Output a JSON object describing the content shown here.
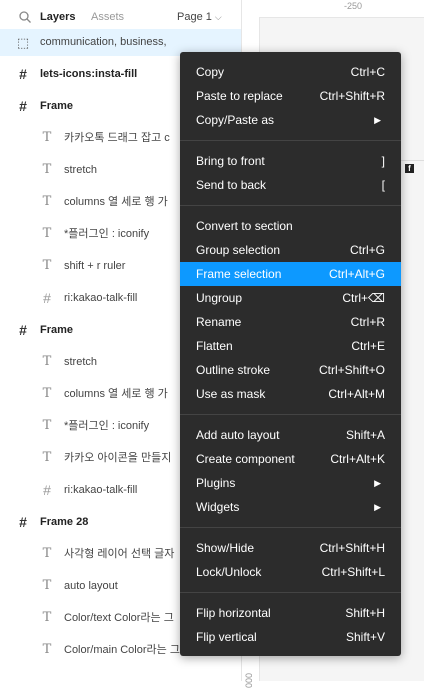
{
  "panel": {
    "tabs": {
      "layers": "Layers",
      "assets": "Assets"
    },
    "page_selector": "Page 1",
    "layers": [
      {
        "label": "communication, business, ",
        "icon": "dashed-frame",
        "indent": 0,
        "bold": false,
        "selected": true
      },
      {
        "label": "lets-icons:insta-fill",
        "icon": "frame",
        "indent": 0,
        "bold": true,
        "selected": false
      },
      {
        "label": "Frame",
        "icon": "frame",
        "indent": 0,
        "bold": true,
        "selected": false
      },
      {
        "label": "카카오톡 드래그 잡고 c",
        "icon": "text",
        "indent": 1,
        "bold": false,
        "selected": false
      },
      {
        "label": "stretch",
        "icon": "text",
        "indent": 1,
        "bold": false,
        "selected": false
      },
      {
        "label": "columns 열 세로 행 가",
        "icon": "text",
        "indent": 1,
        "bold": false,
        "selected": false
      },
      {
        "label": "*플러그인 : iconify",
        "icon": "text",
        "indent": 1,
        "bold": false,
        "selected": false
      },
      {
        "label": "shift + r ruler",
        "icon": "text",
        "indent": 1,
        "bold": false,
        "selected": false
      },
      {
        "label": "ri:kakao-talk-fill",
        "icon": "grid",
        "indent": 1,
        "bold": false,
        "selected": false
      },
      {
        "label": "Frame",
        "icon": "frame",
        "indent": 0,
        "bold": true,
        "selected": false
      },
      {
        "label": "stretch",
        "icon": "text",
        "indent": 1,
        "bold": false,
        "selected": false
      },
      {
        "label": "columns 열 세로 행 가",
        "icon": "text",
        "indent": 1,
        "bold": false,
        "selected": false
      },
      {
        "label": "*플러그인 : iconify",
        "icon": "text",
        "indent": 1,
        "bold": false,
        "selected": false
      },
      {
        "label": "카카오 아이콘을 만들지",
        "icon": "text",
        "indent": 1,
        "bold": false,
        "selected": false
      },
      {
        "label": "ri:kakao-talk-fill",
        "icon": "grid",
        "indent": 1,
        "bold": false,
        "selected": false
      },
      {
        "label": "Frame 28",
        "icon": "frame",
        "indent": 0,
        "bold": true,
        "selected": false
      },
      {
        "label": "사각형 레이어 선택 글자",
        "icon": "text",
        "indent": 1,
        "bold": false,
        "selected": false
      },
      {
        "label": "auto layout",
        "icon": "text",
        "indent": 1,
        "bold": false,
        "selected": false
      },
      {
        "label": "Color/text Color라는 그",
        "icon": "text",
        "indent": 1,
        "bold": false,
        "selected": false
      },
      {
        "label": "Color/main Color라는 그룹안에...",
        "icon": "text",
        "indent": 1,
        "bold": false,
        "selected": false
      }
    ]
  },
  "canvas": {
    "ruler_top_label": "-250",
    "ruler_left_label": "000"
  },
  "menu": {
    "groups": [
      [
        {
          "label": "Copy",
          "shortcut": "Ctrl+C"
        },
        {
          "label": "Paste to replace",
          "shortcut": "Ctrl+Shift+R"
        },
        {
          "label": "Copy/Paste as",
          "shortcut": "",
          "submenu": true
        }
      ],
      [
        {
          "label": "Bring to front",
          "shortcut": "]"
        },
        {
          "label": "Send to back",
          "shortcut": "["
        }
      ],
      [
        {
          "label": "Convert to section",
          "shortcut": ""
        },
        {
          "label": "Group selection",
          "shortcut": "Ctrl+G"
        },
        {
          "label": "Frame selection",
          "shortcut": "Ctrl+Alt+G",
          "highlighted": true
        },
        {
          "label": "Ungroup",
          "shortcut": "Ctrl+⌫"
        },
        {
          "label": "Rename",
          "shortcut": "Ctrl+R"
        },
        {
          "label": "Flatten",
          "shortcut": "Ctrl+E"
        },
        {
          "label": "Outline stroke",
          "shortcut": "Ctrl+Shift+O"
        },
        {
          "label": "Use as mask",
          "shortcut": "Ctrl+Alt+M"
        }
      ],
      [
        {
          "label": "Add auto layout",
          "shortcut": "Shift+A"
        },
        {
          "label": "Create component",
          "shortcut": "Ctrl+Alt+K"
        },
        {
          "label": "Plugins",
          "shortcut": "",
          "submenu": true
        },
        {
          "label": "Widgets",
          "shortcut": "",
          "submenu": true
        }
      ],
      [
        {
          "label": "Show/Hide",
          "shortcut": "Ctrl+Shift+H"
        },
        {
          "label": "Lock/Unlock",
          "shortcut": "Ctrl+Shift+L"
        }
      ],
      [
        {
          "label": "Flip horizontal",
          "shortcut": "Shift+H"
        },
        {
          "label": "Flip vertical",
          "shortcut": "Shift+V"
        }
      ]
    ]
  },
  "colors": {
    "menu_bg": "#2c2c2c",
    "highlight": "#0d99ff",
    "selected_row": "#e5f4ff"
  }
}
